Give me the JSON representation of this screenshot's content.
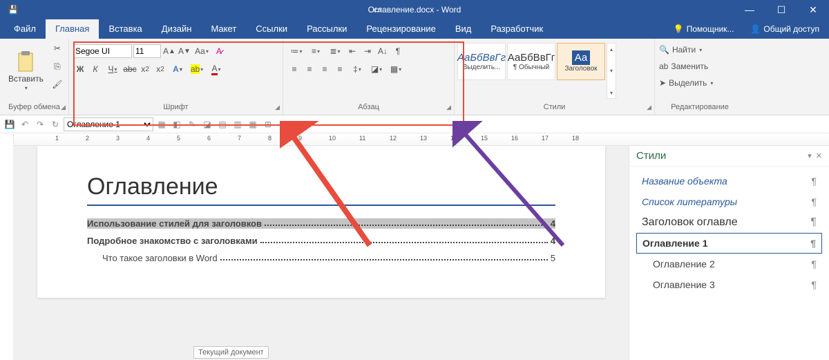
{
  "title": "Оглавление.docx - Word",
  "tabs": [
    "Файл",
    "Главная",
    "Вставка",
    "Дизайн",
    "Макет",
    "Ссылки",
    "Рассылки",
    "Рецензирование",
    "Вид",
    "Разработчик"
  ],
  "activeTab": 1,
  "help": "Помощник...",
  "share": "Общий доступ",
  "clipboard": {
    "paste": "Вставить",
    "label": "Буфер обмена"
  },
  "font": {
    "name": "Segoe UI",
    "size": "11",
    "label": "Шрифт",
    "bold": "Ж",
    "italic": "К",
    "underline": "Ч",
    "strike": "abc"
  },
  "para": {
    "label": "Абзац"
  },
  "styles": {
    "label": "Стили",
    "gallery": [
      {
        "preview": "АаБбВвГг",
        "name": "Выделить..."
      },
      {
        "preview": "АаБбВвГг",
        "name": "¶ Обычный"
      },
      {
        "preview": "Аа",
        "name": "Заголовок",
        "heading": true
      }
    ]
  },
  "editing": {
    "label": "Редактирование",
    "find": "Найти",
    "replace": "Заменить",
    "select": "Выделить"
  },
  "qat": {
    "styleSel": "Оглавление 1"
  },
  "ruler": [
    1,
    2,
    3,
    4,
    5,
    6,
    7,
    8,
    9,
    10,
    11,
    12,
    13,
    14,
    15,
    16,
    17,
    18
  ],
  "doc": {
    "title": "Оглавление",
    "lines": [
      {
        "text": "Использование стилей для заголовков",
        "page": "4",
        "b": true,
        "hl": true
      },
      {
        "text": "Подробное знакомство с заголовками",
        "page": "4",
        "b": true
      },
      {
        "text": "Что такое заголовки в Word",
        "page": "5",
        "indent": true
      }
    ],
    "tooltip": "Текущий документ"
  },
  "stylesPane": {
    "title": "Стили",
    "items": [
      {
        "label": "Название объекта",
        "type": "i"
      },
      {
        "label": "Список литературы",
        "type": "i"
      },
      {
        "label": "Заголовок оглавле",
        "type": "h"
      },
      {
        "label": "Оглавление 1",
        "type": "sel"
      },
      {
        "label": "Оглавление 2",
        "type": "indent"
      },
      {
        "label": "Оглавление 3",
        "type": "indent"
      }
    ]
  }
}
